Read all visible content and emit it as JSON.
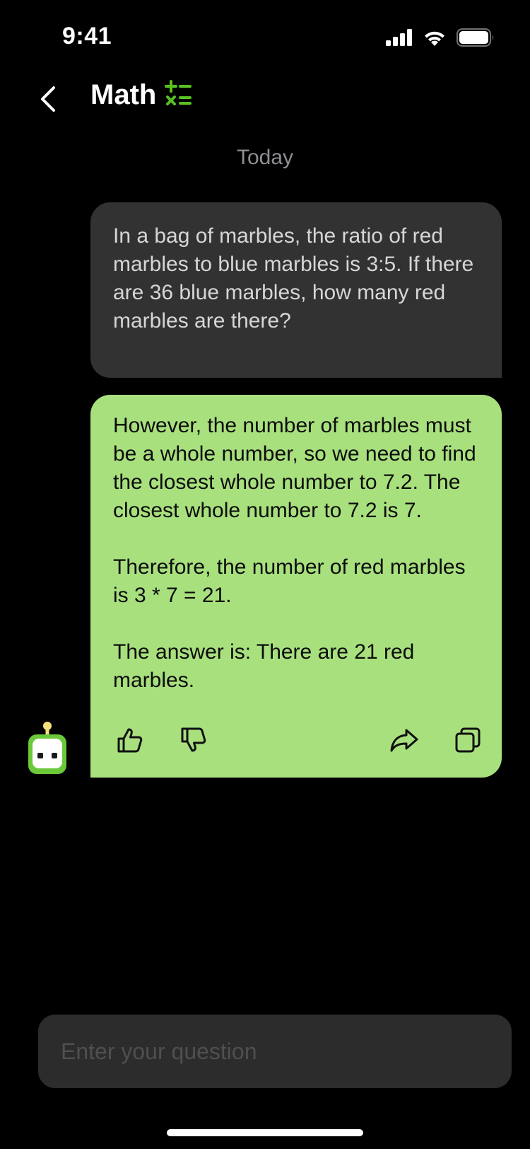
{
  "status_bar": {
    "time": "9:41",
    "icons": [
      "cellular-signal-icon",
      "wifi-icon",
      "battery-icon"
    ]
  },
  "header": {
    "back_icon": "chevron-left-icon",
    "title": "Math",
    "title_icon": "math-operators-icon",
    "accent_color": "#58c020"
  },
  "date_label": "Today",
  "messages": {
    "user": {
      "text": "In a bag of marbles, the ratio of red marbles to blue marbles is 3:5. If there are 36 blue marbles, how many red marbles are there?",
      "background": "#323232"
    },
    "bot": {
      "paragraphs": [
        "However, the number of marbles must be a whole number, so we need to find the closest whole number to 7.2. The closest whole number to 7.2 is 7.",
        "Therefore, the number of red marbles is 3 * 7 = 21.",
        "The answer is: There are 21 red marbles."
      ],
      "background": "#a8e07e",
      "actions": [
        "thumbs-up-icon",
        "thumbs-down-icon",
        "share-icon",
        "copy-icon"
      ]
    }
  },
  "input": {
    "placeholder": "Enter your question",
    "value": ""
  }
}
